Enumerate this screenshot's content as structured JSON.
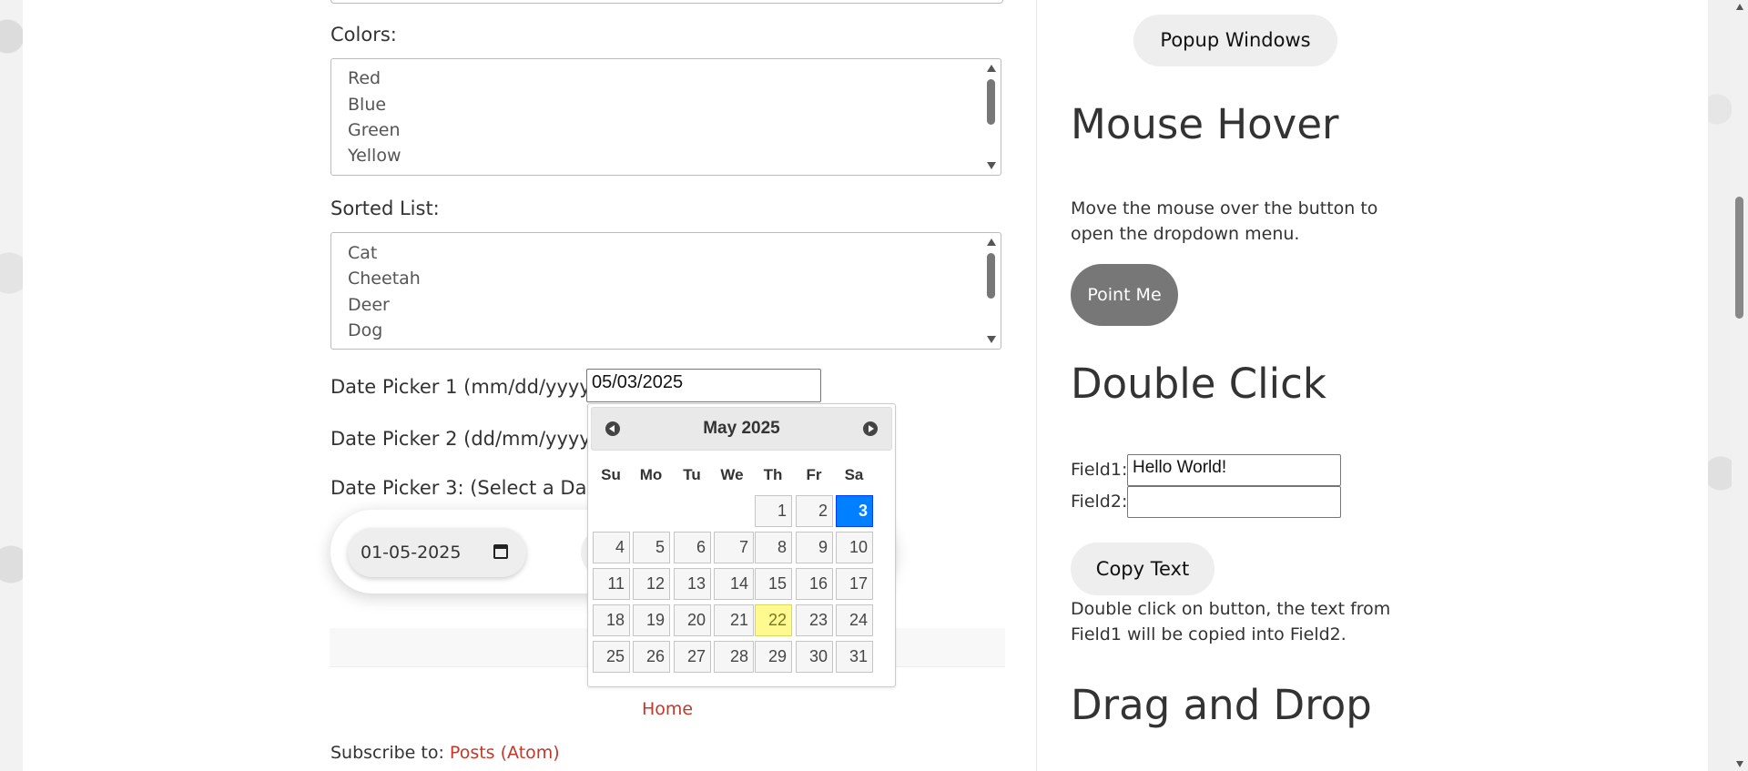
{
  "left": {
    "colors_label": "Colors:",
    "colors": [
      "Red",
      "Blue",
      "Green",
      "Yellow"
    ],
    "sorted_label": "Sorted List:",
    "sorted": [
      "Cat",
      "Cheetah",
      "Deer",
      "Dog"
    ],
    "dp1_label": "Date Picker 1 (mm/dd/yyyy):",
    "dp1_value": "05/03/2025",
    "dp2_label": "Date Picker 2 (dd/mm/yyyy) :",
    "dp3_label": "Date Picker 3: (Select a Date R",
    "dp3_start": "01-05-2025",
    "home_link": "Home",
    "subscribe_label": "Subscribe to:",
    "subscribe_link": "Posts (Atom)"
  },
  "datepicker": {
    "title": "May 2025",
    "prev_icon": "prev-arrow-icon",
    "next_icon": "next-arrow-icon",
    "weekdays": [
      "Su",
      "Mo",
      "Tu",
      "We",
      "Th",
      "Fr",
      "Sa"
    ],
    "first_weekday_index": 4,
    "days_in_month": 31,
    "selected_day": 3,
    "today_day": 22,
    "selected_color": "#007fff",
    "today_color": "#fffa90"
  },
  "right": {
    "popup_button": "Popup Windows",
    "mouse_hover_title": "Mouse Hover",
    "mouse_hover_text_1": "Move the mouse over the button to",
    "mouse_hover_text_2": "open the dropdown menu.",
    "point_me": "Point Me",
    "double_click_title": "Double Click",
    "field1_label": "Field1:",
    "field1_value": "Hello World!",
    "field2_label": "Field2:",
    "field2_value": "",
    "copy_button": "Copy Text",
    "double_click_text_1": "Double click on button, the text from",
    "double_click_text_2": "Field1 will be copied into Field2.",
    "drag_drop_title": "Drag and Drop"
  }
}
